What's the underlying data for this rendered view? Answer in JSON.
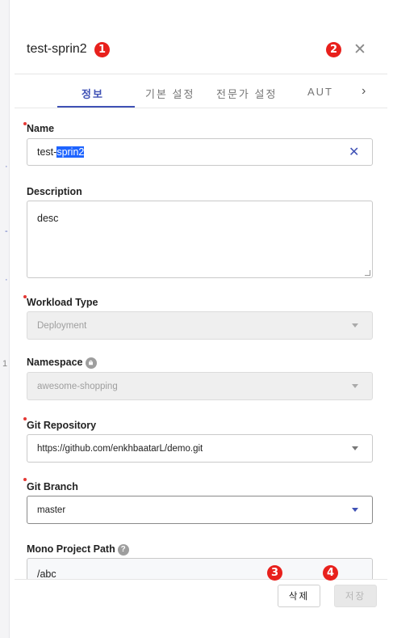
{
  "header": {
    "title": "test-sprin2",
    "close_glyph": "✕"
  },
  "badges": {
    "b1": "1",
    "b2": "2",
    "b3": "3",
    "b4": "4"
  },
  "tabs": [
    {
      "label": "정보",
      "active": true
    },
    {
      "label": "기본 설정"
    },
    {
      "label": "전문가 설정"
    },
    {
      "label": "AUT"
    }
  ],
  "tab_next_glyph": "›",
  "backdrop_marks": {
    "m1": "1"
  },
  "form": {
    "name": {
      "label": "Name",
      "value_prefix": "test-",
      "value_selected": "sprin2",
      "clear_glyph": "✕"
    },
    "description": {
      "label": "Description",
      "value": "desc"
    },
    "workload_type": {
      "label": "Workload Type",
      "value": "Deployment"
    },
    "namespace": {
      "label": "Namespace",
      "value": "awesome-shopping",
      "icon": "lock-icon"
    },
    "git_repository": {
      "label": "Git Repository",
      "value": "https://github.com/enkhbaatarL/demo.git"
    },
    "git_branch": {
      "label": "Git Branch",
      "value": "master"
    },
    "mono_project_path": {
      "label": "Mono Project Path",
      "value": "/abc",
      "icon": "help-icon"
    }
  },
  "footer": {
    "delete_label": "삭제",
    "save_label": "저장"
  },
  "colors": {
    "accent": "#3f51b5",
    "required": "#e53935",
    "badge": "#e8201c",
    "selection": "#1e64ff"
  }
}
